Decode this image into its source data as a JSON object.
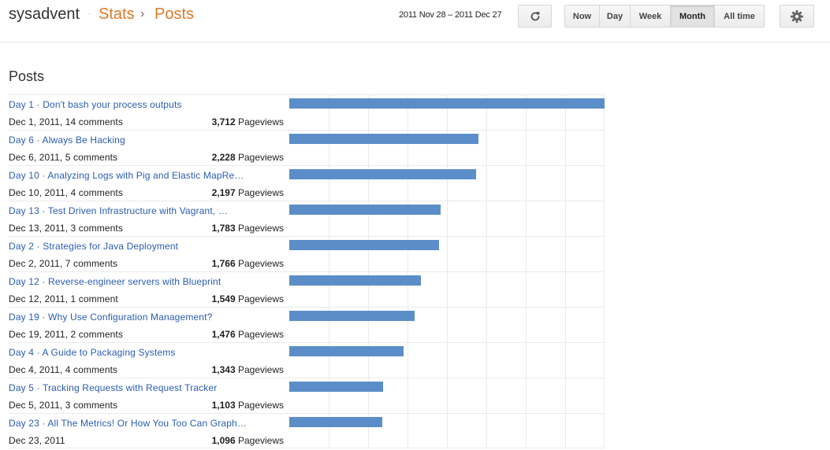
{
  "header": {
    "brand": "sysadvent",
    "crumb_sep": "·",
    "crumb_stats": "Stats",
    "crumb_arrow": "›",
    "crumb_posts": "Posts",
    "date_range": "2011 Nov 28 – 2011 Dec 27",
    "refresh_icon": "refresh-icon",
    "settings_icon": "gear-icon",
    "periods": [
      "Now",
      "Day",
      "Week",
      "Month",
      "All time"
    ],
    "active_period": "Month"
  },
  "section_title": "Posts",
  "views_label": "Pageviews",
  "bar_color": "#5b8ec8",
  "accent_color": "#dd7a28",
  "max_views": 3712,
  "posts": [
    {
      "title": "Day 1 · Don't bash your process outputs",
      "meta": "Dec 1, 2011, 14 comments",
      "views": "3,712",
      "value": 3712
    },
    {
      "title": "Day 6 · Always Be Hacking",
      "meta": "Dec 6, 2011, 5 comments",
      "views": "2,228",
      "value": 2228
    },
    {
      "title": "Day 10 · Analyzing Logs with Pig and Elastic MapRe…",
      "meta": "Dec 10, 2011, 4 comments",
      "views": "2,197",
      "value": 2197
    },
    {
      "title": "Day 13 · Test Driven Infrastructure with Vagrant, …",
      "meta": "Dec 13, 2011, 3 comments",
      "views": "1,783",
      "value": 1783
    },
    {
      "title": "Day 2 · Strategies for Java Deployment",
      "meta": "Dec 2, 2011, 7 comments",
      "views": "1,766",
      "value": 1766
    },
    {
      "title": "Day 12 · Reverse-engineer servers with Blueprint",
      "meta": "Dec 12, 2011, 1 comment",
      "views": "1,549",
      "value": 1549
    },
    {
      "title": "Day 19 · Why Use Configuration Management?",
      "meta": "Dec 19, 2011, 2 comments",
      "views": "1,476",
      "value": 1476
    },
    {
      "title": "Day 4 · A Guide to Packaging Systems",
      "meta": "Dec 4, 2011, 4 comments",
      "views": "1,343",
      "value": 1343
    },
    {
      "title": "Day 5 · Tracking Requests with Request Tracker",
      "meta": "Dec 5, 2011, 3 comments",
      "views": "1,103",
      "value": 1103
    },
    {
      "title": "Day 23 · All The Metrics! Or How You Too Can Graph…",
      "meta": "Dec 23, 2011",
      "views": "1,096",
      "value": 1096
    }
  ]
}
